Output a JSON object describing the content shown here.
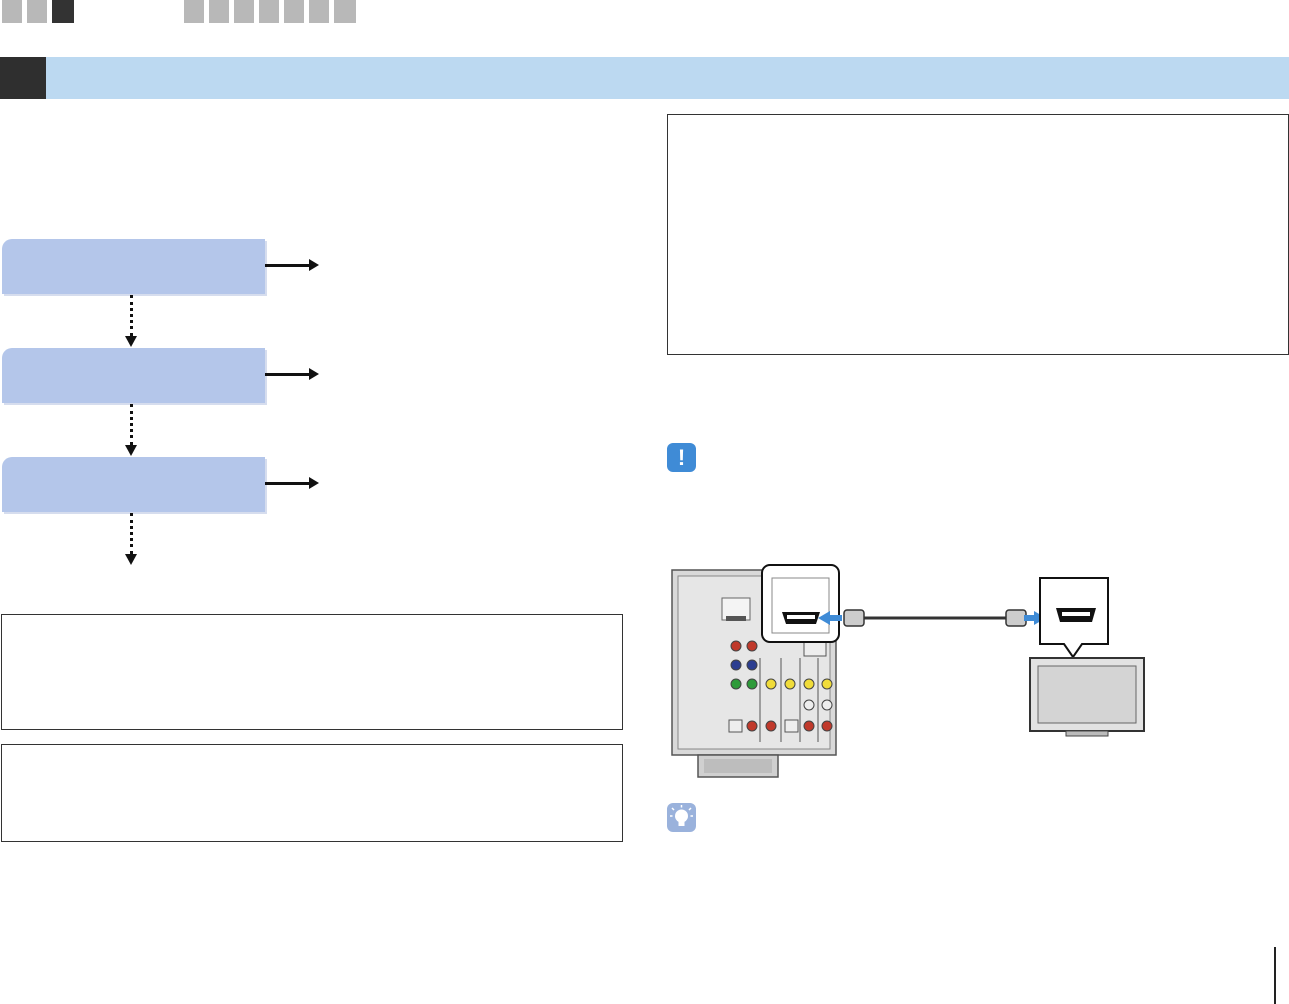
{
  "nav": {
    "tabs_left": [
      {
        "state": "inactive"
      },
      {
        "state": "inactive"
      },
      {
        "state": "active"
      }
    ],
    "tabs_right": [
      {
        "state": "inactive"
      },
      {
        "state": "inactive"
      },
      {
        "state": "inactive"
      },
      {
        "state": "inactive"
      },
      {
        "state": "inactive"
      },
      {
        "state": "inactive"
      },
      {
        "state": "inactive"
      },
      {
        "state": "inactive"
      }
    ]
  },
  "section": {
    "number": "",
    "title": ""
  },
  "flow": {
    "steps": [
      {
        "label": "",
        "target": ""
      },
      {
        "label": "",
        "target": ""
      },
      {
        "label": "",
        "target": ""
      }
    ]
  },
  "notes": {
    "right_top": "",
    "left_1": "",
    "left_2": ""
  },
  "icons": {
    "caution": "caution-icon",
    "hint": "hint-icon",
    "caution_glyph": "!"
  },
  "colors": {
    "section_bar": "#bcd9f1",
    "flow_box": "#b4c6ea",
    "active_tab": "#333333",
    "inactive_tab": "#b8b8b8",
    "connector_arrow": "#3f8bd6"
  }
}
